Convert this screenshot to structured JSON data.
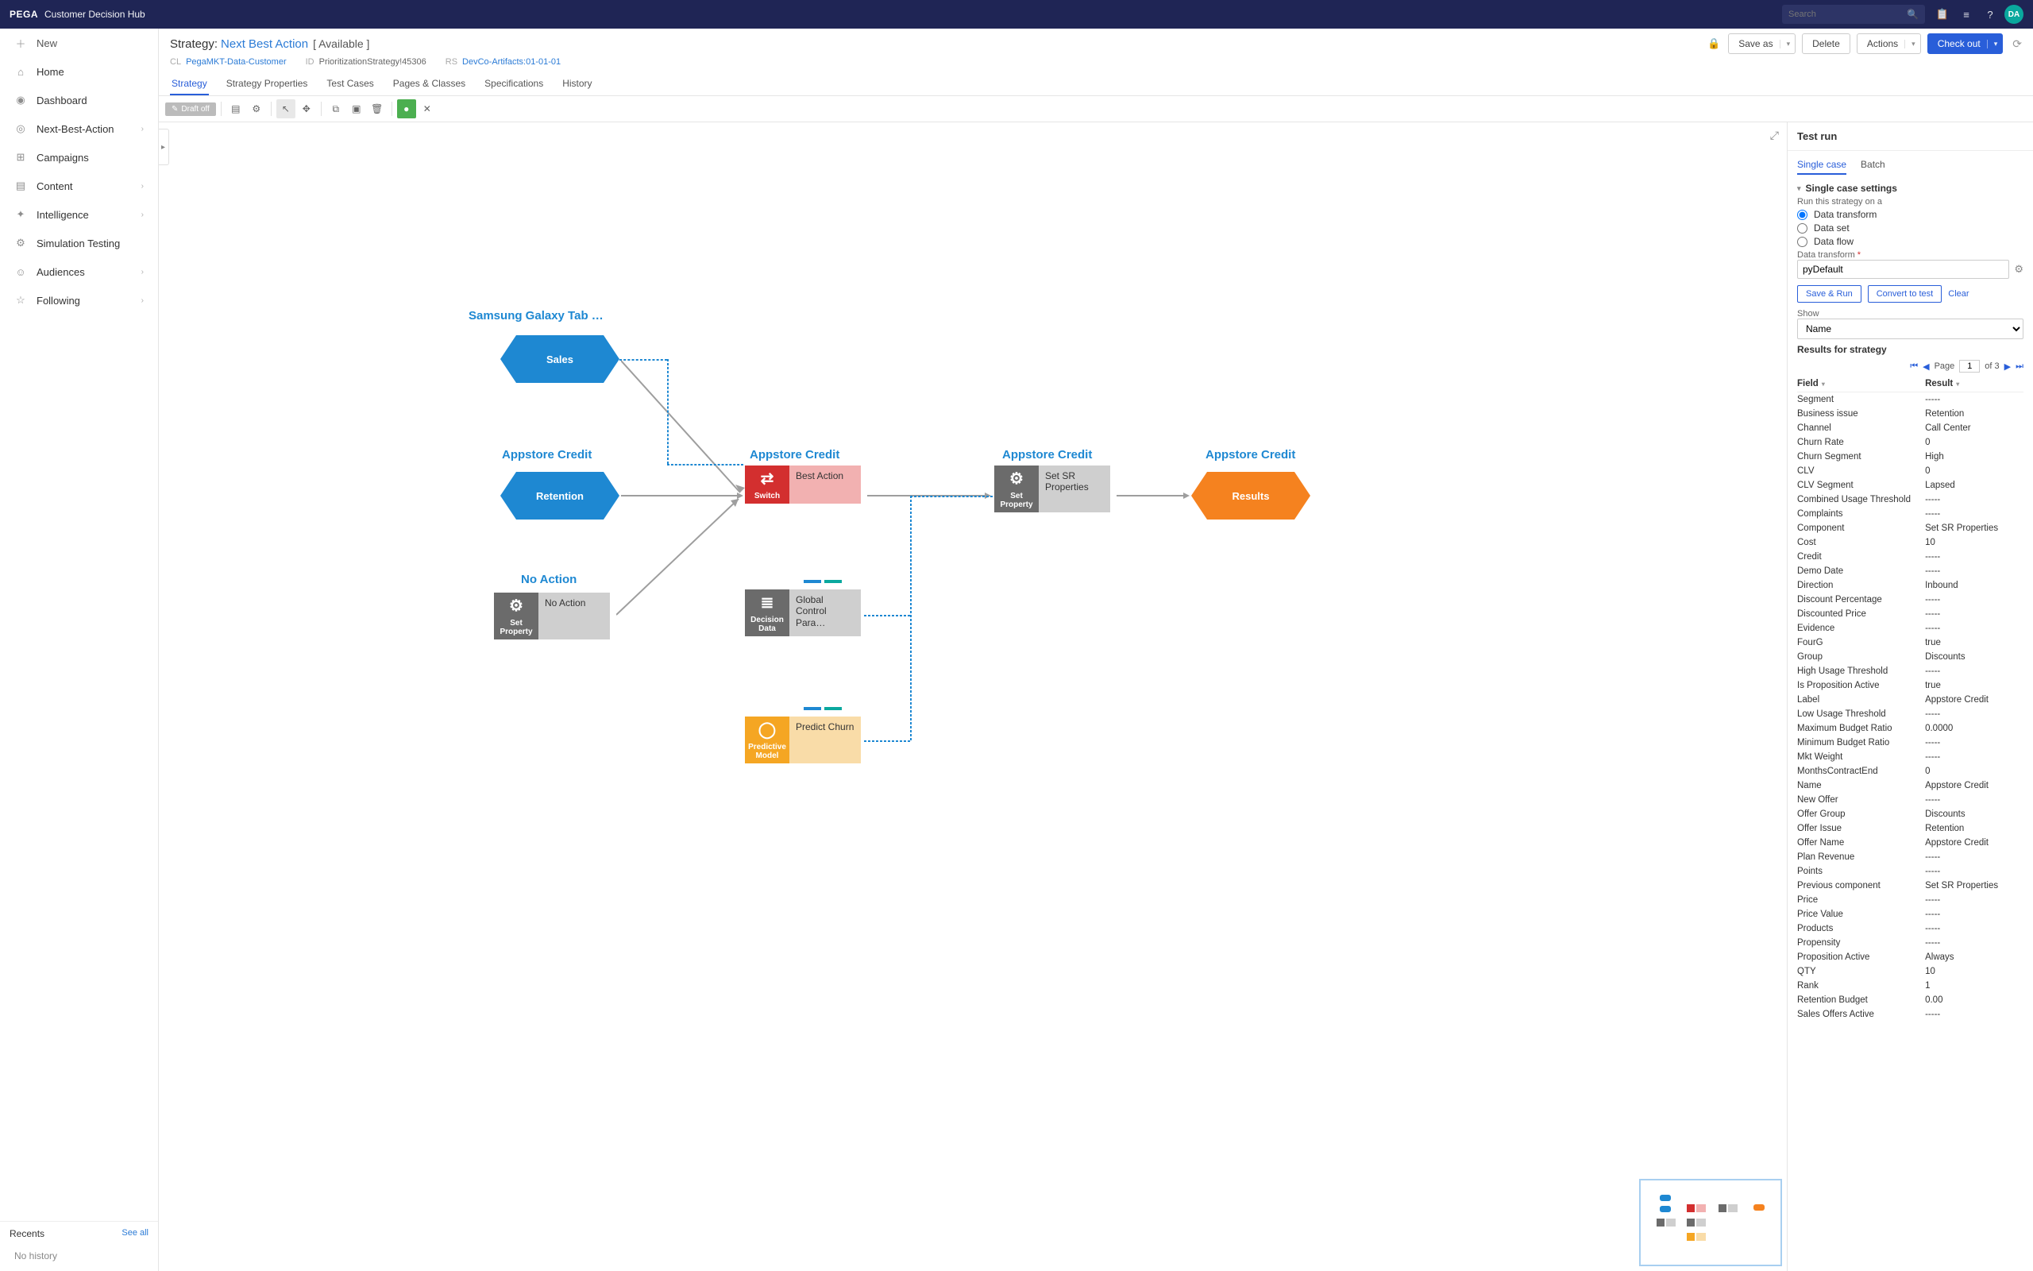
{
  "top": {
    "brand": "PEGA",
    "app": "Customer Decision Hub",
    "search_placeholder": "Search",
    "avatar": "DA"
  },
  "sidebar": {
    "new": "New",
    "items": [
      {
        "label": "Home",
        "icon": "⌂",
        "chev": false
      },
      {
        "label": "Dashboard",
        "icon": "◉",
        "chev": false
      },
      {
        "label": "Next-Best-Action",
        "icon": "◎",
        "chev": true
      },
      {
        "label": "Campaigns",
        "icon": "⊞",
        "chev": false
      },
      {
        "label": "Content",
        "icon": "▤",
        "chev": true
      },
      {
        "label": "Intelligence",
        "icon": "✦",
        "chev": true
      },
      {
        "label": "Simulation Testing",
        "icon": "⚙",
        "chev": false
      },
      {
        "label": "Audiences",
        "icon": "☺",
        "chev": true
      },
      {
        "label": "Following",
        "icon": "☆",
        "chev": true
      }
    ],
    "recents": "Recents",
    "seeall": "See all",
    "nohistory": "No history"
  },
  "header": {
    "label": "Strategy:",
    "name": "Next Best Action",
    "status": "[ Available ]",
    "meta": [
      {
        "k": "CL",
        "v": "PegaMKT-Data-Customer",
        "link": true
      },
      {
        "k": "ID",
        "v": "PrioritizationStrategy!45306",
        "link": false
      },
      {
        "k": "RS",
        "v": "DevCo-Artifacts:01-01-01",
        "link": true
      }
    ],
    "buttons": {
      "saveas": "Save as",
      "delete": "Delete",
      "actions": "Actions",
      "checkout": "Check out"
    }
  },
  "tabs": [
    "Strategy",
    "Strategy Properties",
    "Test Cases",
    "Pages & Classes",
    "Specifications",
    "History"
  ],
  "toolbar": {
    "draft": "Draft off"
  },
  "canvas": {
    "l_samsung": "Samsung Galaxy Tab …",
    "l_appstore1": "Appstore Credit",
    "l_appstore2": "Appstore Credit",
    "l_appstore3": "Appstore Credit",
    "l_appstore4": "Appstore Credit",
    "l_noaction": "No Action",
    "hex_sales": "Sales",
    "hex_retention": "Retention",
    "hex_results": "Results",
    "shp_switch": {
      "icon": "Switch",
      "txt": "Best Action"
    },
    "shp_setsr": {
      "icon": "Set Property",
      "txt": "Set SR Properties"
    },
    "shp_noaction": {
      "icon": "Set Property",
      "txt": "No Action"
    },
    "shp_decision": {
      "icon": "Decision Data",
      "txt": "Global Control Para…"
    },
    "shp_predict": {
      "icon": "Predictive Model",
      "txt": "Predict Churn"
    }
  },
  "right": {
    "title": "Test run",
    "subtabs": [
      "Single case",
      "Batch"
    ],
    "sec": "Single case settings",
    "runon": "Run this strategy on a",
    "radios": [
      "Data transform",
      "Data set",
      "Data flow"
    ],
    "dt_label": "Data transform",
    "dt_value": "pyDefault",
    "saverun": "Save & Run",
    "convert": "Convert to test",
    "clear": "Clear",
    "show": "Show",
    "show_val": "Name",
    "results_hdr": "Results for strategy",
    "page": "Page",
    "page_val": "1",
    "of3": "of 3",
    "cols": [
      "Field",
      "Result"
    ],
    "rows": [
      [
        "Segment",
        "-----"
      ],
      [
        "Business issue",
        "Retention"
      ],
      [
        "Channel",
        "Call Center"
      ],
      [
        "Churn Rate",
        "0"
      ],
      [
        "Churn Segment",
        "High"
      ],
      [
        "CLV",
        "0"
      ],
      [
        "CLV Segment",
        "Lapsed"
      ],
      [
        "Combined Usage Threshold",
        "-----"
      ],
      [
        "Complaints",
        "-----"
      ],
      [
        "Component",
        "Set SR Properties"
      ],
      [
        "Cost",
        "10"
      ],
      [
        "Credit",
        "-----"
      ],
      [
        "Demo Date",
        "-----"
      ],
      [
        "Direction",
        "Inbound"
      ],
      [
        "Discount Percentage",
        "-----"
      ],
      [
        "Discounted Price",
        "-----"
      ],
      [
        "Evidence",
        "-----"
      ],
      [
        "FourG",
        "true"
      ],
      [
        "Group",
        "Discounts"
      ],
      [
        "High Usage Threshold",
        "-----"
      ],
      [
        "Is Proposition Active",
        "true"
      ],
      [
        "Label",
        "Appstore Credit"
      ],
      [
        "Low Usage Threshold",
        "-----"
      ],
      [
        "Maximum Budget Ratio",
        "0.0000"
      ],
      [
        "Minimum Budget Ratio",
        "-----"
      ],
      [
        "Mkt Weight",
        "-----"
      ],
      [
        "MonthsContractEnd",
        "0"
      ],
      [
        "Name",
        "Appstore Credit"
      ],
      [
        "New Offer",
        "-----"
      ],
      [
        "Offer Group",
        "Discounts"
      ],
      [
        "Offer Issue",
        "Retention"
      ],
      [
        "Offer Name",
        "Appstore Credit"
      ],
      [
        "Plan Revenue",
        "-----"
      ],
      [
        "Points",
        "-----"
      ],
      [
        "Previous component",
        "Set SR Properties"
      ],
      [
        "Price",
        "-----"
      ],
      [
        "Price Value",
        "-----"
      ],
      [
        "Products",
        "-----"
      ],
      [
        "Propensity",
        "-----"
      ],
      [
        "Proposition Active",
        "Always"
      ],
      [
        "QTY",
        "10"
      ],
      [
        "Rank",
        "1"
      ],
      [
        "Retention Budget",
        "0.00"
      ],
      [
        "Sales Offers Active",
        "-----"
      ]
    ]
  }
}
